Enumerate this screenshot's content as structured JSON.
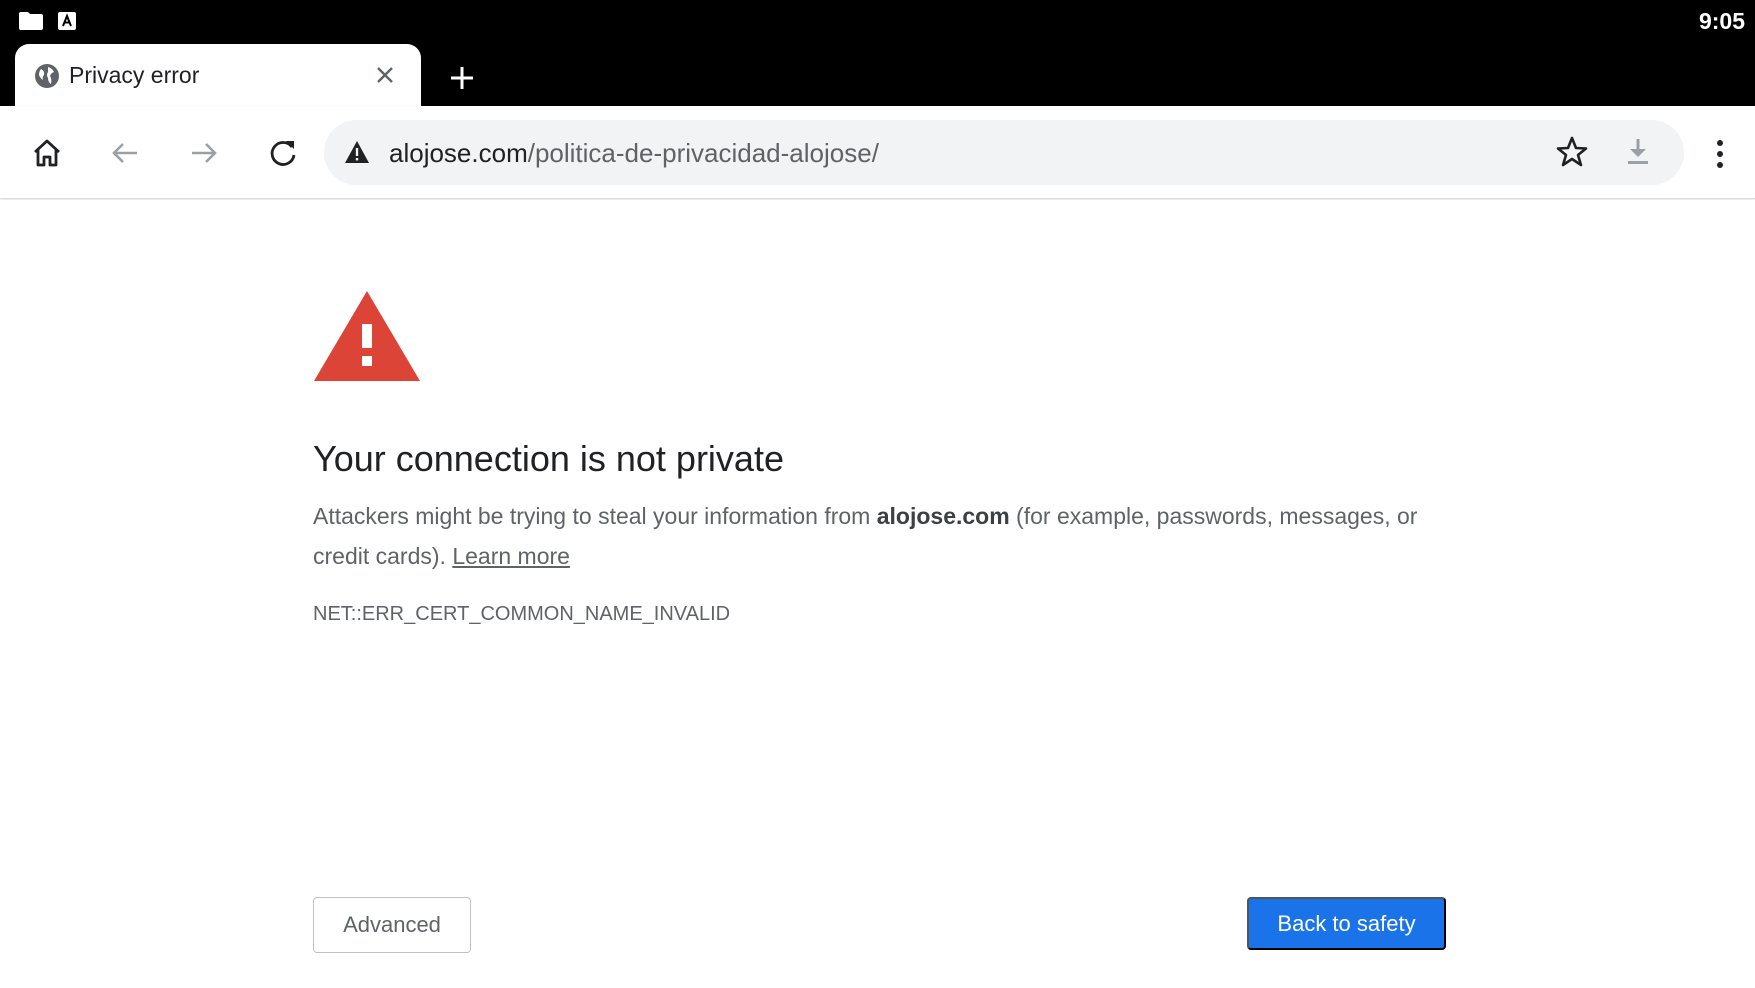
{
  "status_bar": {
    "time": "9:05",
    "icons": [
      "folder-icon",
      "text-a-icon"
    ]
  },
  "tab": {
    "title": "Privacy error",
    "icon": "globe-icon"
  },
  "toolbar": {
    "url_host": "alojose.com",
    "url_path": "/politica-de-privacidad-alojose/",
    "icons": [
      "home-icon",
      "back-icon",
      "forward-icon",
      "reload-icon",
      "warning-icon",
      "star-icon",
      "download-icon",
      "more-menu-icon"
    ]
  },
  "page": {
    "heading": "Your connection is not private",
    "desc_before": "Attackers might be trying to steal your information from ",
    "desc_host": "alojose.com",
    "desc_after": " (for example, passwords, messages, or credit cards). ",
    "learn_more": "Learn more",
    "error_code": "NET::ERR_CERT_COMMON_NAME_INVALID",
    "advanced_label": "Advanced",
    "back_label": "Back to safety"
  },
  "colors": {
    "warning_red": "#db4437",
    "primary_blue": "#1a73e8",
    "text_dark": "#202124",
    "text_muted": "#5f6368"
  }
}
